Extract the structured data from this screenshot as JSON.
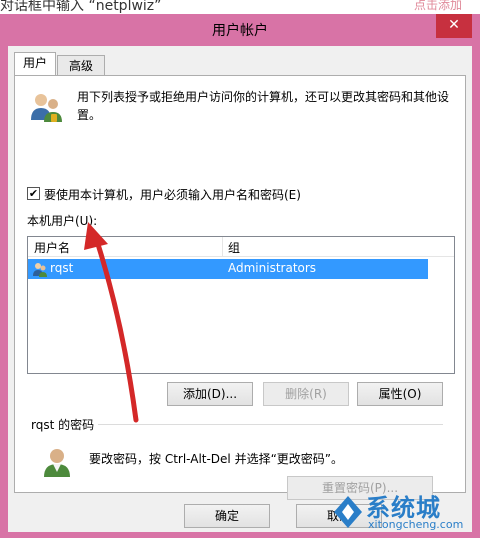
{
  "background": {
    "left_text": "对话框中输入 “netplwiz”",
    "right_text": "点击添加"
  },
  "window": {
    "title": "用户帐户",
    "close_label": "✕"
  },
  "tabs": [
    {
      "label": "用户",
      "active": true
    },
    {
      "label": "高级",
      "active": false
    }
  ],
  "info": {
    "text": "用下列表授予或拒绝用户访问你的计算机，还可以更改其密码和其他设置。",
    "icon": "users-icon"
  },
  "require_password": {
    "checked": true,
    "label": "要使用本计算机，用户必须输入用户名和密码(E)"
  },
  "users_list": {
    "label": "本机用户(U):",
    "columns": [
      "用户名",
      "组"
    ],
    "rows": [
      {
        "name": "rqst",
        "group": "Administrators",
        "selected": true
      }
    ]
  },
  "buttons": {
    "add": "添加(D)...",
    "remove": "删除(R)",
    "properties": "属性(O)",
    "reset_password": "重置密码(P)...",
    "ok": "确定",
    "cancel": "取消"
  },
  "password_group": {
    "title": "rqst 的密码",
    "text": "要改密码，按 Ctrl-Alt-Del 并选择“更改密码”。"
  },
  "watermark": {
    "text": "系统城",
    "url": "xitongcheng.com"
  },
  "colors": {
    "frame": "#d873a6",
    "selection": "#3399ff",
    "close": "#c7303f",
    "arrow": "#d42828"
  }
}
